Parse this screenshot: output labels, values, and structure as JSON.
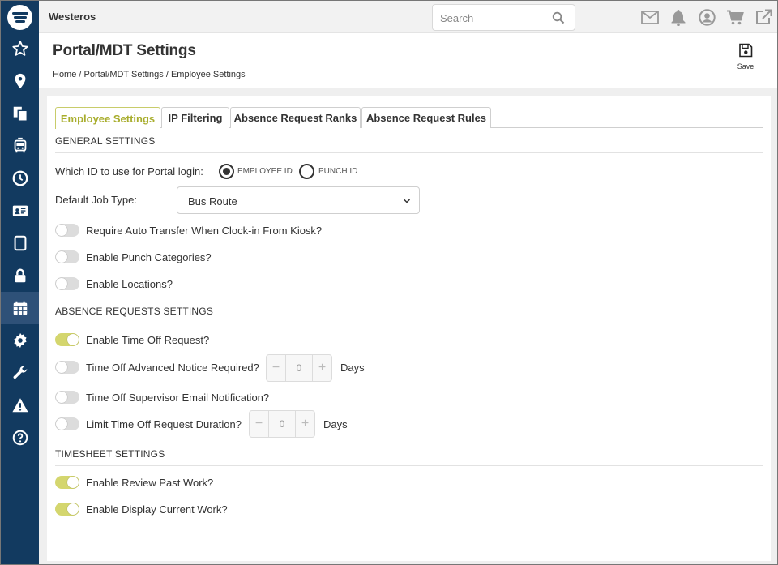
{
  "app": {
    "brand": "Westeros"
  },
  "search": {
    "placeholder": "Search"
  },
  "topbar_icons": [
    "mail-icon",
    "bell-icon",
    "user-icon",
    "cart-icon",
    "external-link-icon"
  ],
  "sidebar": {
    "items": [
      {
        "icon": "star-icon"
      },
      {
        "icon": "map-pin-icon"
      },
      {
        "icon": "documents-icon"
      },
      {
        "icon": "bus-icon"
      },
      {
        "icon": "clock-icon"
      },
      {
        "icon": "id-card-icon"
      },
      {
        "icon": "tablet-icon"
      },
      {
        "icon": "lock-icon"
      },
      {
        "icon": "calendar-icon",
        "active": true
      },
      {
        "icon": "gear-icon"
      },
      {
        "icon": "wrench-icon"
      },
      {
        "icon": "warning-icon"
      },
      {
        "icon": "help-icon"
      }
    ]
  },
  "page": {
    "title": "Portal/MDT Settings",
    "breadcrumb": [
      "Home",
      "Portal/MDT Settings",
      "Employee Settings"
    ],
    "breadcrumb_sep": "/",
    "save_label": "Save"
  },
  "tabs": [
    "Employee Settings",
    "IP Filtering",
    "Absence Request Ranks",
    "Absence Request Rules"
  ],
  "active_tab": 0,
  "general": {
    "heading": "GENERAL SETTINGS",
    "portal_login_label": "Which ID to use for Portal login:",
    "portal_login_options": [
      "EMPLOYEE ID",
      "PUNCH ID"
    ],
    "portal_login_selected": "EMPLOYEE ID",
    "job_type_label": "Default Job Type:",
    "job_type_value": "Bus Route",
    "toggles": [
      {
        "label": "Require Auto Transfer When Clock-in From Kiosk?",
        "on": false
      },
      {
        "label": "Enable Punch Categories?",
        "on": false
      },
      {
        "label": "Enable Locations?",
        "on": false
      }
    ]
  },
  "absence": {
    "heading": "ABSENCE REQUESTS SETTINGS",
    "time_off_request": {
      "label": "Enable Time Off Request?",
      "on": true
    },
    "advanced_notice": {
      "label": "Time Off Advanced Notice Required?",
      "on": false,
      "value": "0",
      "unit": "Days"
    },
    "supervisor_email": {
      "label": "Time Off Supervisor Email Notification?",
      "on": false
    },
    "limit_duration": {
      "label": "Limit Time Off Request Duration?",
      "on": false,
      "value": "0",
      "unit": "Days"
    }
  },
  "timesheet": {
    "heading": "TIMESHEET SETTINGS",
    "toggles": [
      {
        "label": "Enable Review Past Work?",
        "on": true
      },
      {
        "label": "Enable Display Current Work?",
        "on": true
      }
    ]
  },
  "colors": {
    "sidebar": "#123a60",
    "sidebar_active": "#2e5178",
    "accent": "#a8ad2c",
    "toggle_on": "#d4d66e"
  }
}
